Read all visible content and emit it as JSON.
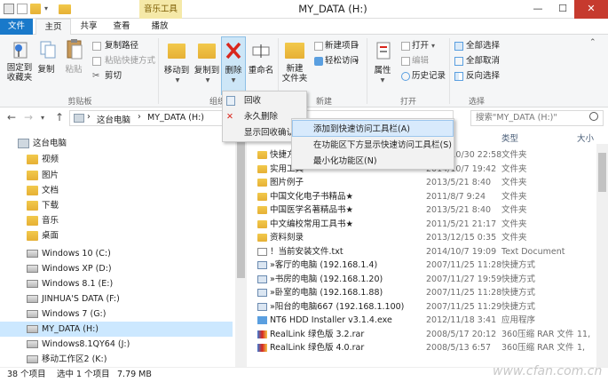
{
  "window": {
    "title": "MY_DATA (H:)",
    "context_tab": "音乐工具",
    "minimize": "—",
    "maximize": "☐",
    "close": "✕"
  },
  "tabs": [
    {
      "label": "文件"
    },
    {
      "label": "主页"
    },
    {
      "label": "共享"
    },
    {
      "label": "查看"
    },
    {
      "label": "播放"
    }
  ],
  "ribbon": {
    "clipboard": {
      "pin": "固定到\n收藏夹",
      "copy": "复制",
      "paste": "粘贴",
      "copy_path": "复制路径",
      "paste_shortcut": "粘贴快捷方式",
      "cut": "剪切",
      "group": "剪贴板"
    },
    "organize": {
      "move_to": "移动到",
      "copy_to": "复制到",
      "delete": "删除",
      "rename": "重命名",
      "group": "组织"
    },
    "new": {
      "new_folder": "新建\n文件夹",
      "new_item": "新建项目",
      "easy_access": "轻松访问",
      "group": "新建"
    },
    "open": {
      "properties": "属性",
      "open": "打开",
      "edit": "编辑",
      "history": "历史记录",
      "group": "打开"
    },
    "select": {
      "select_all": "全部选择",
      "select_none": "全部取消",
      "invert": "反向选择",
      "group": "选择"
    }
  },
  "delete_menu": {
    "items": [
      "回收",
      "永久删除",
      "显示回收确认"
    ]
  },
  "qat_menu": {
    "items": [
      "添加到快速访问工具栏(A)",
      "在功能区下方显示快速访问工具栏(S)",
      "最小化功能区(N)"
    ]
  },
  "address": {
    "back": "←",
    "forward": "→",
    "up": "↑",
    "path": [
      "这台电脑",
      "MY_DATA (H:)"
    ],
    "sep": "›",
    "search_placeholder": "搜索\"MY_DATA (H:)\""
  },
  "nav_tree": [
    {
      "label": "这台电脑",
      "icon": "computer-icon"
    },
    {
      "label": "视频",
      "icon": "video-folder-icon"
    },
    {
      "label": "图片",
      "icon": "pictures-folder-icon"
    },
    {
      "label": "文档",
      "icon": "documents-folder-icon"
    },
    {
      "label": "下载",
      "icon": "downloads-folder-icon"
    },
    {
      "label": "音乐",
      "icon": "music-folder-icon"
    },
    {
      "label": "桌面",
      "icon": "desktop-folder-icon"
    },
    {
      "label": "Windows 10 (C:)",
      "icon": "drive-icon"
    },
    {
      "label": "Windows XP (D:)",
      "icon": "drive-icon"
    },
    {
      "label": "Windows 8.1 (E:)",
      "icon": "drive-icon"
    },
    {
      "label": "JINHUA'S DATA (F:)",
      "icon": "drive-icon"
    },
    {
      "label": "Windows 7 (G:)",
      "icon": "drive-icon"
    },
    {
      "label": "MY_DATA (H:)",
      "icon": "drive-icon"
    },
    {
      "label": "Windows8.1QY64 (J:)",
      "icon": "drive-icon"
    },
    {
      "label": "移动工作区2 (K:)",
      "icon": "drive-icon"
    }
  ],
  "file_list": {
    "columns": {
      "type": "类型",
      "size": "大小"
    },
    "rows": [
      {
        "name": "快捷方式",
        "date": "2014/10/30 22:58",
        "type": "文件夹",
        "size": ""
      },
      {
        "name": "实用工具",
        "date": "2014/10/7 19:42",
        "type": "文件夹",
        "size": ""
      },
      {
        "name": "图片例子",
        "date": "2013/5/21 8:40",
        "type": "文件夹",
        "size": ""
      },
      {
        "name": "中国文化电子书精品★",
        "date": "2011/8/7 9:24",
        "type": "文件夹",
        "size": ""
      },
      {
        "name": "中国医学名著精品书★",
        "date": "2013/5/21 8:40",
        "type": "文件夹",
        "size": ""
      },
      {
        "name": "中文编校常用工具书★",
        "date": "2011/5/21 21:17",
        "type": "文件夹",
        "size": ""
      },
      {
        "name": "资料刻录",
        "date": "2013/12/15 0:35",
        "type": "文件夹",
        "size": ""
      },
      {
        "name": "！当前安装文件.txt",
        "date": "2014/10/7 19:09",
        "type": "Text Document",
        "size": ""
      },
      {
        "name": "»客厅的电脑 (192.168.1.4)",
        "date": "2007/11/25 11:28",
        "type": "快捷方式",
        "size": ""
      },
      {
        "name": "»书房的电脑 (192.168.1.20)",
        "date": "2007/11/27 19:59",
        "type": "快捷方式",
        "size": ""
      },
      {
        "name": "»卧室的电脑 (192.168.1.88)",
        "date": "2007/11/25 11:28",
        "type": "快捷方式",
        "size": ""
      },
      {
        "name": "»阳台的电脑667 (192.168.1.100)",
        "date": "2007/11/25 11:29",
        "type": "快捷方式",
        "size": ""
      },
      {
        "name": "NT6 HDD Installer v3.1.4.exe",
        "date": "2012/11/18 3:41",
        "type": "应用程序",
        "size": ""
      },
      {
        "name": "RealLink 绿色版 3.2.rar",
        "date": "2008/5/17 20:12",
        "type": "360压缩 RAR 文件",
        "size": "11,"
      },
      {
        "name": "RealLink 绿色版 4.0.rar",
        "date": "2008/5/13 6:57",
        "type": "360压缩 RAR 文件",
        "size": "1,"
      }
    ]
  },
  "status": {
    "count": "38 个项目",
    "selected": "选中 1 个项目",
    "size": "7.79 MB"
  },
  "watermark": "www.cfan.com.cn",
  "colors": {
    "accent": "#1979ca",
    "context_tab": "#f5e9a8",
    "close": "#c63a2e",
    "selection": "#cce8ff",
    "delete_red": "#d9261c"
  }
}
